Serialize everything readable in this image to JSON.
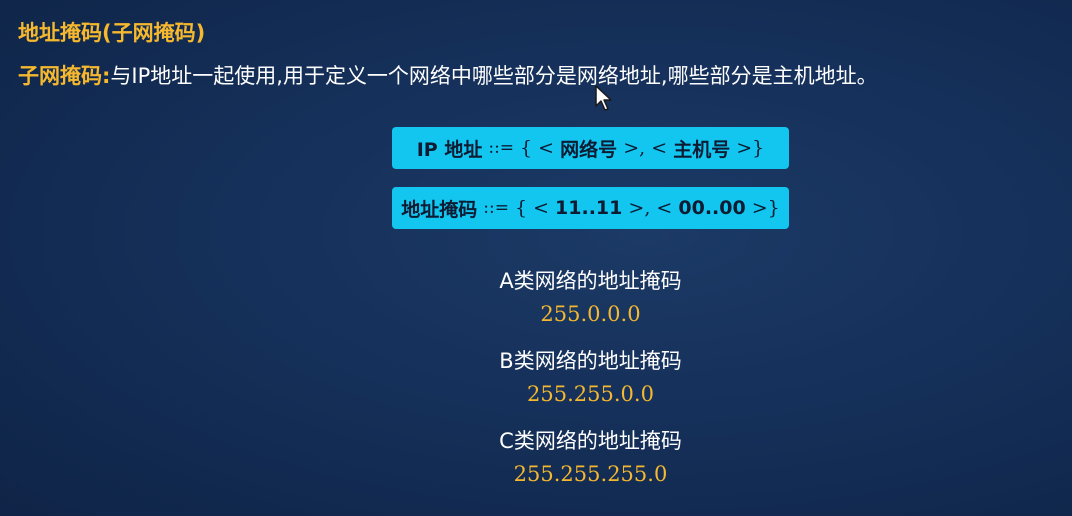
{
  "title": "地址掩码(子网掩码)",
  "definition": {
    "label": "子网掩码:",
    "text": "与IP地址一起使用,用于定义一个网络中哪些部分是网络地址,哪些部分是主机地址。"
  },
  "formula_ip": {
    "lhs": "IP 地址",
    "op": "::=",
    "open": "{ <",
    "part1": "网络号",
    "mid": ">, <",
    "part2": "主机号",
    "close": ">}"
  },
  "formula_mask": {
    "lhs": "地址掩码",
    "op": "::=",
    "open": "{ <",
    "part1": "11..11",
    "mid": ">, <",
    "part2": "00..00",
    "close": ">}"
  },
  "classes": [
    {
      "label": "A类网络的地址掩码",
      "mask": "255.0.0.0"
    },
    {
      "label": "B类网络的地址掩码",
      "mask": "255.255.0.0"
    },
    {
      "label": "C类网络的地址掩码",
      "mask": "255.255.255.0"
    }
  ],
  "icons": {
    "cursor": "mouse-pointer-icon"
  },
  "colors": {
    "accent": "#f5b82e",
    "pill": "#12c6f0",
    "background": "#15305a"
  }
}
